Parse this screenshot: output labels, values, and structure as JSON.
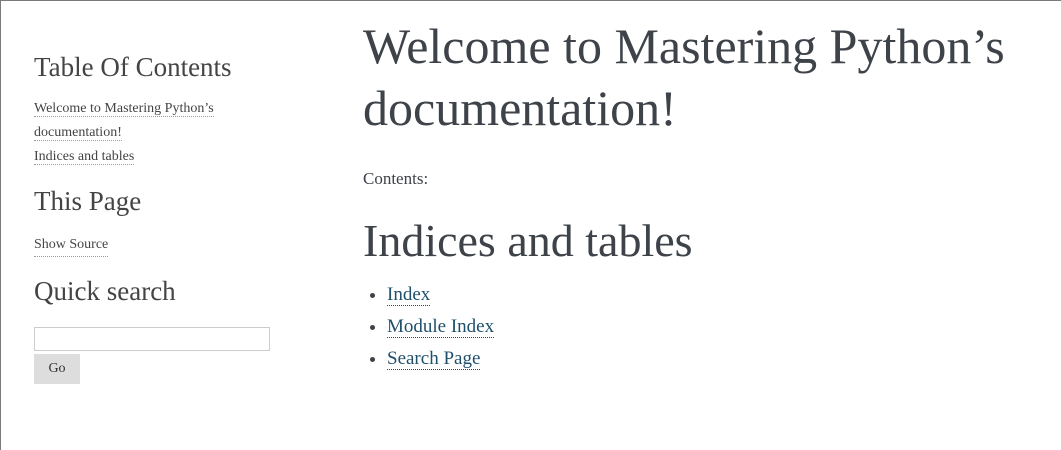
{
  "sidebar": {
    "toc_title": "Table Of Contents",
    "toc_items": [
      {
        "label": "Welcome to Mastering Python’s documentation!"
      },
      {
        "label": "Indices and tables"
      }
    ],
    "this_page_title": "This Page",
    "show_source_label": "Show Source",
    "search_title": "Quick search",
    "search_value": "",
    "go_label": "Go"
  },
  "main": {
    "title": "Welcome to Mastering Python’s documentation!",
    "contents_caption": "Contents:",
    "indices_heading": "Indices and tables",
    "index_links": [
      {
        "label": "Index"
      },
      {
        "label": "Module Index"
      },
      {
        "label": "Search Page"
      }
    ]
  },
  "colors": {
    "link": "#1f4f6a",
    "text": "#3e4349",
    "button_bg": "#dddddd"
  }
}
